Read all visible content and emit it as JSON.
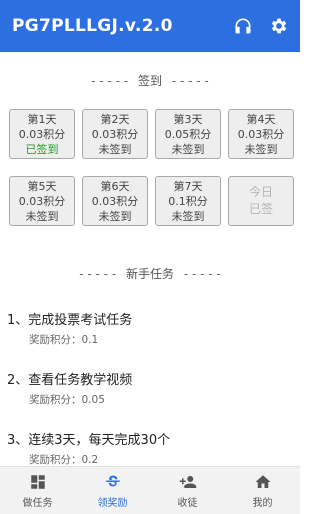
{
  "header": {
    "title": "PG7PLLLGJ.v.2.0",
    "icons": [
      "headphones-icon",
      "gear-icon"
    ]
  },
  "checkin": {
    "dashes_left": "- - - - -",
    "title": "签到",
    "dashes_right": "- - - - -",
    "days": [
      {
        "day": "第1天",
        "points": "0.03积分",
        "status": "已签到"
      },
      {
        "day": "第2天",
        "points": "0.03积分",
        "status": "未签到"
      },
      {
        "day": "第3天",
        "points": "0.05积分",
        "status": "未签到"
      },
      {
        "day": "第4天",
        "points": "0.03积分",
        "status": "未签到"
      },
      {
        "day": "第5天",
        "points": "0.03积分",
        "status": "未签到"
      },
      {
        "day": "第6天",
        "points": "0.03积分",
        "status": "未签到"
      },
      {
        "day": "第7天",
        "points": "0.1积分",
        "status": "未签到"
      }
    ],
    "today": {
      "line1": "今日",
      "line2": "已签"
    }
  },
  "newbie": {
    "dashes_left": "- - - - -",
    "title": "新手任务",
    "dashes_right": "- - - - -",
    "tasks": [
      {
        "title": "1、完成投票考试任务",
        "reward": "奖励积分：0.1"
      },
      {
        "title": "2、查看任务教学视频",
        "reward": "奖励积分：0.05"
      },
      {
        "title": "3、连续3天，每天完成30个",
        "reward": "奖励积分：0.2"
      }
    ]
  },
  "tabbar": {
    "tabs": [
      {
        "label": "做任务",
        "icon": "dashboard-icon"
      },
      {
        "label": "领奖励",
        "icon": "strikethrough-s-icon"
      },
      {
        "label": "收徒",
        "icon": "add-person-icon"
      },
      {
        "label": "我的",
        "icon": "home-icon"
      }
    ]
  },
  "colors": {
    "accent": "#2d6fe0",
    "signed": "#1e9c29"
  }
}
